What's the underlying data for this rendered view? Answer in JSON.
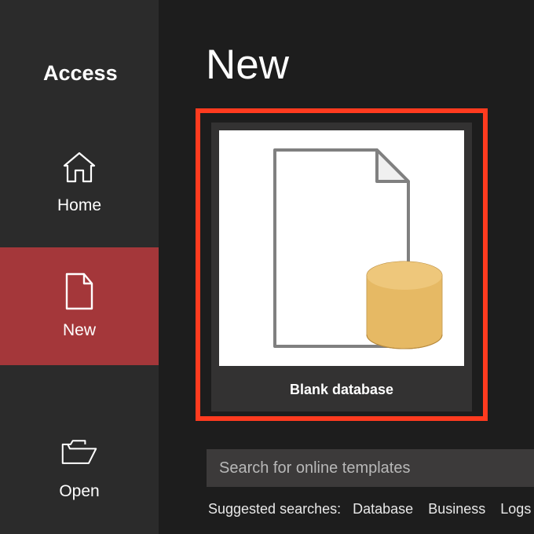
{
  "app": {
    "title": "Access"
  },
  "sidebar": {
    "items": [
      {
        "label": "Home"
      },
      {
        "label": "New"
      },
      {
        "label": "Open"
      }
    ],
    "selected_index": 1
  },
  "page": {
    "title": "New"
  },
  "template_tile": {
    "label": "Blank database"
  },
  "search": {
    "placeholder": "Search for online templates"
  },
  "suggested": {
    "label": "Suggested searches:",
    "links": [
      "Database",
      "Business",
      "Logs"
    ]
  },
  "colors": {
    "accent": "#a4373a",
    "highlight": "#ff3b1f"
  }
}
